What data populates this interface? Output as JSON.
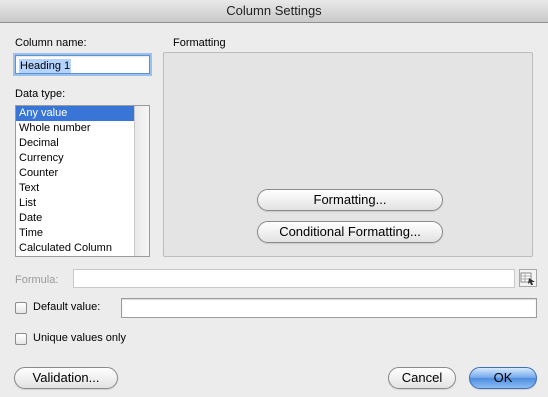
{
  "window": {
    "title": "Column Settings"
  },
  "column_name": {
    "label": "Column name:",
    "value": "Heading 1"
  },
  "data_type": {
    "label": "Data type:",
    "selected": "Any value",
    "options": [
      "Any value",
      "Whole number",
      "Decimal",
      "Currency",
      "Counter",
      "Text",
      "List",
      "Date",
      "Time",
      "Calculated Column"
    ]
  },
  "formatting": {
    "label": "Formatting",
    "formatting_button": "Formatting...",
    "conditional_button": "Conditional Formatting..."
  },
  "formula": {
    "label": "Formula:",
    "value": "",
    "button_icon": "formula-builder-icon"
  },
  "default_value": {
    "label": "Default value:",
    "checked": false,
    "value": ""
  },
  "unique": {
    "label": "Unique values only",
    "checked": false
  },
  "buttons": {
    "validation": "Validation...",
    "cancel": "Cancel",
    "ok": "OK"
  },
  "colors": {
    "selection": "#3875d7",
    "default_button": "#5a95e4",
    "focus_ring": "#9cc0ee"
  }
}
